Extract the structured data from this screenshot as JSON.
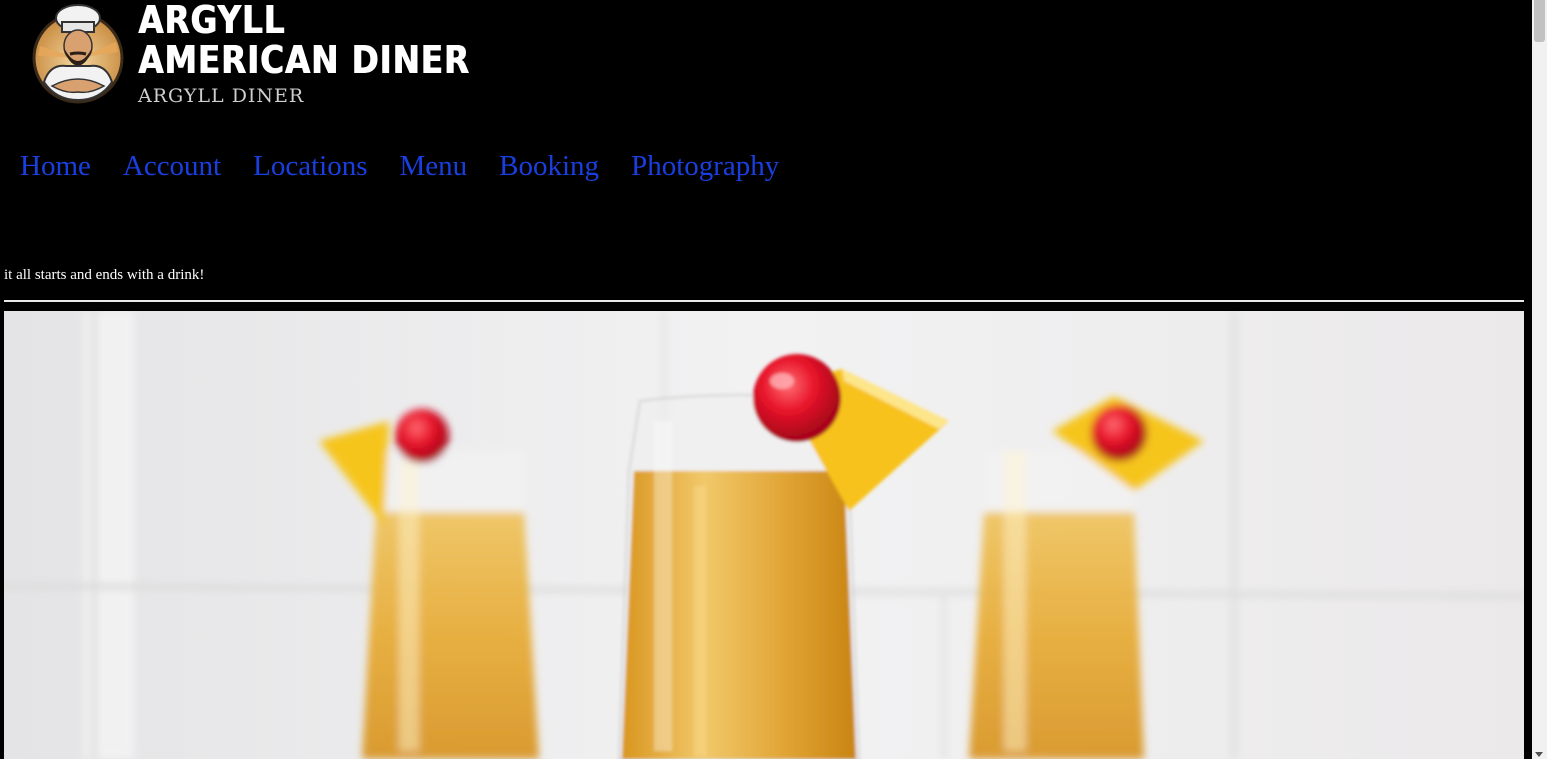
{
  "brand": {
    "title_line1": "ARGYLL",
    "title_line2": "AMERICAN DINER",
    "subtitle": "ARGYLL DINER",
    "logo_icon": "chef-mascot-logo"
  },
  "nav": {
    "items": [
      {
        "label": "Home"
      },
      {
        "label": "Account"
      },
      {
        "label": "Locations"
      },
      {
        "label": "Menu"
      },
      {
        "label": "Booking"
      },
      {
        "label": "Photography"
      }
    ],
    "link_color": "#1a3fe0"
  },
  "main": {
    "tagline": "it all starts and ends with a drink!",
    "hero_image": "three-cocktail-glasses-with-cherry-and-orange-garnish"
  },
  "colors": {
    "background": "#000000",
    "text": "#ffffff"
  }
}
